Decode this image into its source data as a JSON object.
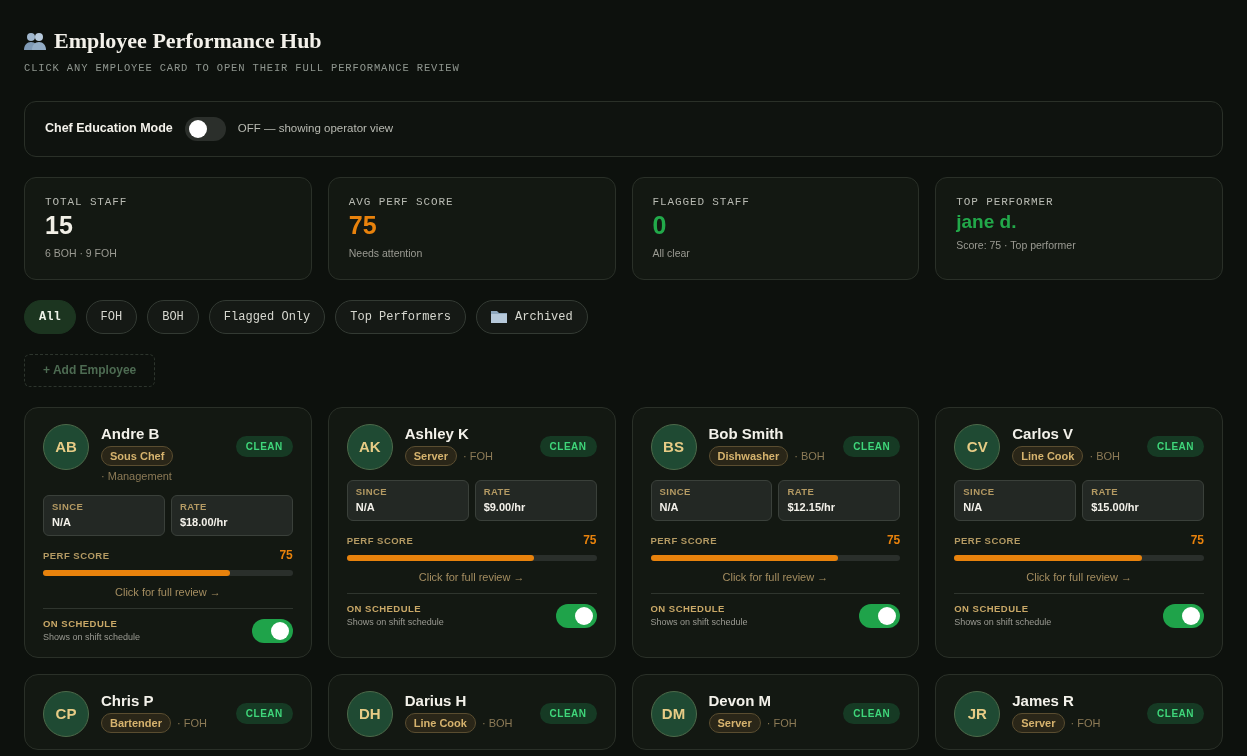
{
  "header": {
    "title": "Employee Performance Hub",
    "subtitle": "CLICK ANY EMPLOYEE CARD TO OPEN THEIR FULL PERFORMANCE REVIEW"
  },
  "education_mode": {
    "label": "Chef Education Mode",
    "on": false,
    "status": "OFF — showing operator view"
  },
  "stats": [
    {
      "label": "TOTAL STAFF",
      "value": "15",
      "note": "6 BOH · 9 FOH",
      "kind": "plain"
    },
    {
      "label": "AVG PERF SCORE",
      "value": "75",
      "note": "Needs attention",
      "kind": "warn"
    },
    {
      "label": "FLAGGED STAFF",
      "value": "0",
      "note": "All clear",
      "kind": "good"
    },
    {
      "label": "TOP PERFORMER",
      "value": "jane d.",
      "note": "Score: 75 · Top performer",
      "kind": "good"
    }
  ],
  "filters": [
    {
      "label": "All",
      "selected": true,
      "kind": "plain"
    },
    {
      "label": "FOH",
      "selected": false,
      "kind": "plain"
    },
    {
      "label": "BOH",
      "selected": false,
      "kind": "plain"
    },
    {
      "label": "Flagged Only",
      "selected": false,
      "kind": "plain"
    },
    {
      "label": "Top Performers",
      "selected": false,
      "kind": "plain"
    },
    {
      "label": "Archived",
      "selected": false,
      "kind": "folder"
    }
  ],
  "add_button": {
    "label": "+ Add Employee",
    "disabled": true
  },
  "employees": [
    {
      "initials": "AB",
      "name": "Andre B",
      "role": "Sous Chef",
      "dept": "· Management",
      "status": "CLEAN",
      "since_label": "SINCE",
      "since": "N/A",
      "rate_label": "RATE",
      "rate": "$18.00/hr",
      "score_label": "PERF SCORE",
      "score": "75",
      "level": 0.75,
      "link": "Click for full review →",
      "schedule_label": "ON SCHEDULE",
      "schedule_note": "Shows on shift schedule",
      "on_schedule": true
    },
    {
      "initials": "AK",
      "name": "Ashley K",
      "role": "Server",
      "dept": "· FOH",
      "status": "CLEAN",
      "since_label": "SINCE",
      "since": "N/A",
      "rate_label": "RATE",
      "rate": "$9.00/hr",
      "score_label": "PERF SCORE",
      "score": "75",
      "level": 0.75,
      "link": "Click for full review →",
      "schedule_label": "ON SCHEDULE",
      "schedule_note": "Shows on shift schedule",
      "on_schedule": true
    },
    {
      "initials": "BS",
      "name": "Bob Smith",
      "role": "Dishwasher",
      "dept": "· BOH",
      "status": "CLEAN",
      "since_label": "SINCE",
      "since": "N/A",
      "rate_label": "RATE",
      "rate": "$12.15/hr",
      "score_label": "PERF SCORE",
      "score": "75",
      "level": 0.75,
      "link": "Click for full review →",
      "schedule_label": "ON SCHEDULE",
      "schedule_note": "Shows on shift schedule",
      "on_schedule": true
    },
    {
      "initials": "CV",
      "name": "Carlos V",
      "role": "Line Cook",
      "dept": "· BOH",
      "status": "CLEAN",
      "since_label": "SINCE",
      "since": "N/A",
      "rate_label": "RATE",
      "rate": "$15.00/hr",
      "score_label": "PERF SCORE",
      "score": "75",
      "level": 0.75,
      "link": "Click for full review →",
      "schedule_label": "ON SCHEDULE",
      "schedule_note": "Shows on shift schedule",
      "on_schedule": true
    },
    {
      "initials": "CP",
      "name": "Chris P",
      "role": "Bartender",
      "dept": "· FOH",
      "status": "CLEAN"
    },
    {
      "initials": "DH",
      "name": "Darius H",
      "role": "Line Cook",
      "dept": "· BOH",
      "status": "CLEAN"
    },
    {
      "initials": "DM",
      "name": "Devon M",
      "role": "Server",
      "dept": "· FOH",
      "status": "CLEAN"
    },
    {
      "initials": "JR",
      "name": "James R",
      "role": "Server",
      "dept": "· FOH",
      "status": "CLEAN"
    }
  ]
}
